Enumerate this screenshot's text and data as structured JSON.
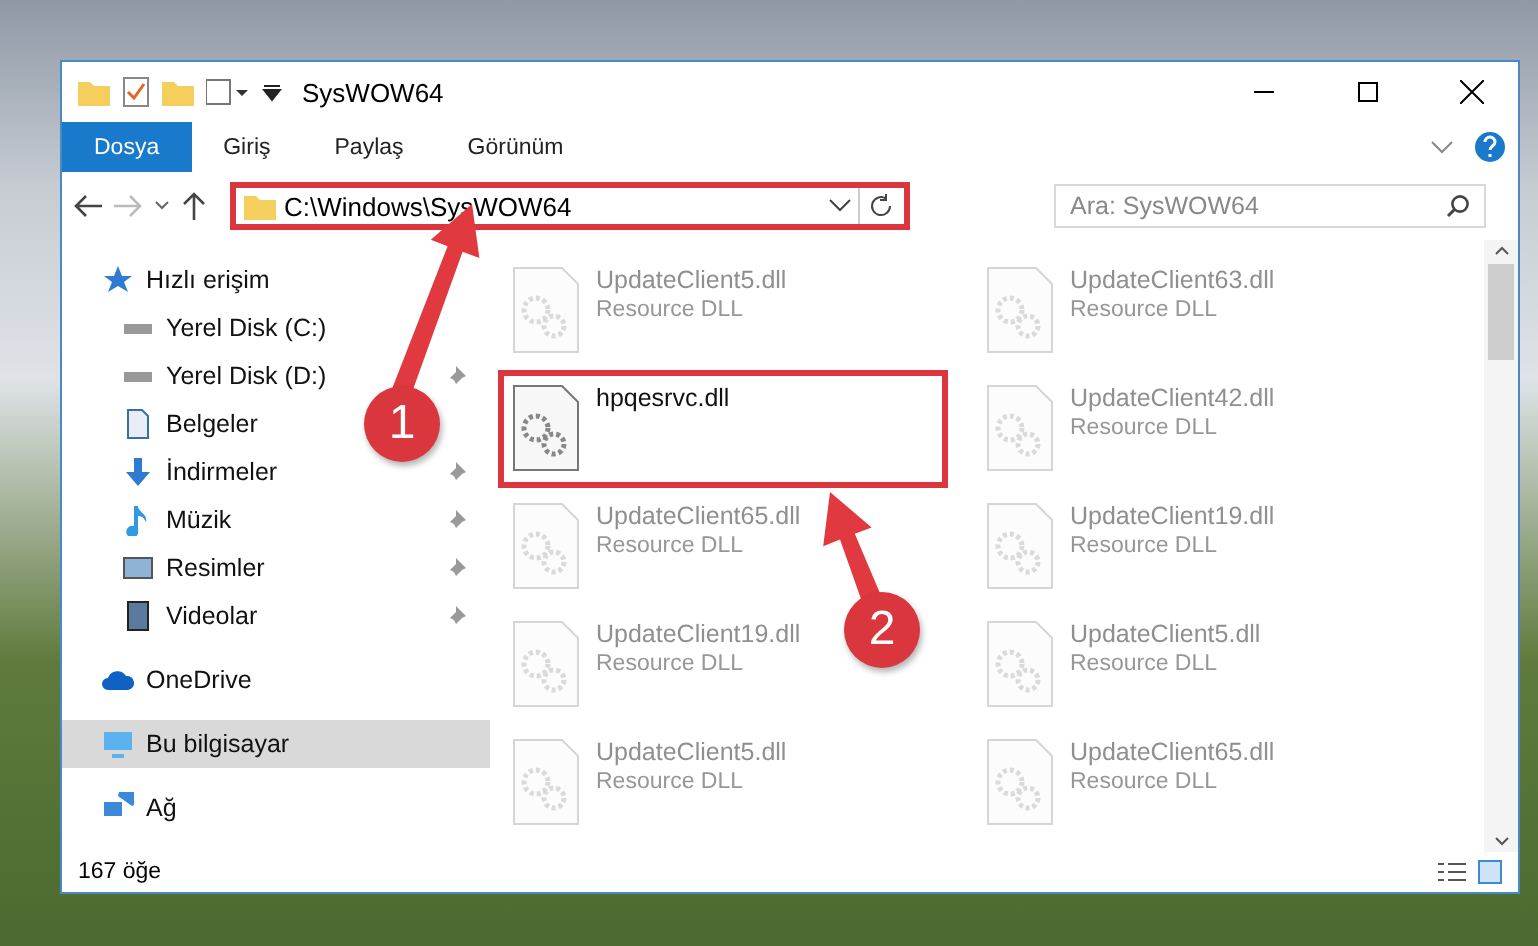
{
  "window": {
    "title": "SysWOW64"
  },
  "ribbon_tabs": [
    {
      "label": "Dosya",
      "selected": true
    },
    {
      "label": "Giriş",
      "selected": false
    },
    {
      "label": "Paylaş",
      "selected": false
    },
    {
      "label": "Görünüm",
      "selected": false
    }
  ],
  "address_bar": {
    "path": "C:\\Windows\\SysWOW64",
    "highlighted": true
  },
  "search": {
    "placeholder": "Ara: SysWOW64"
  },
  "sidebar": {
    "items": [
      {
        "label": "Hızlı erişim",
        "kind": "star",
        "pinned": false,
        "selected": false,
        "children": [
          {
            "label": "Yerel Disk (C:)",
            "kind": "drive",
            "pinned": false,
            "selected": false
          },
          {
            "label": "Yerel Disk (D:)",
            "kind": "drive",
            "pinned": true,
            "selected": false
          },
          {
            "label": "Belgeler",
            "kind": "document",
            "pinned": false,
            "selected": false
          },
          {
            "label": "İndirmeler",
            "kind": "download",
            "pinned": true,
            "selected": false
          },
          {
            "label": "Müzik",
            "kind": "music",
            "pinned": true,
            "selected": false
          },
          {
            "label": "Resimler",
            "kind": "picture",
            "pinned": true,
            "selected": false
          },
          {
            "label": "Videolar",
            "kind": "video",
            "pinned": true,
            "selected": false
          }
        ]
      },
      {
        "label": "OneDrive",
        "kind": "cloud",
        "pinned": false,
        "selected": false
      },
      {
        "label": "Bu bilgisayar",
        "kind": "computer",
        "pinned": false,
        "selected": true
      },
      {
        "label": "Ağ",
        "kind": "network",
        "pinned": false,
        "selected": false
      }
    ]
  },
  "files": [
    {
      "name": "UpdateClient5.dll",
      "type": "Resource DLL",
      "highlighted": false
    },
    {
      "name": "UpdateClient63.dll",
      "type": "Resource DLL",
      "highlighted": false
    },
    {
      "name": "hpqesrvc.dll",
      "highlighted": true
    },
    {
      "name": "UpdateClient42.dll",
      "type": "Resource DLL",
      "highlighted": false
    },
    {
      "name": "UpdateClient65.dll",
      "type": "Resource DLL",
      "highlighted": false
    },
    {
      "name": "UpdateClient19.dll",
      "type": "Resource DLL",
      "highlighted": false
    },
    {
      "name": "UpdateClient19.dll",
      "type": "Resource DLL",
      "highlighted": false
    },
    {
      "name": "UpdateClient5.dll",
      "type": "Resource DLL",
      "highlighted": false
    },
    {
      "name": "UpdateClient5.dll",
      "type": "Resource DLL",
      "highlighted": false
    },
    {
      "name": "UpdateClient65.dll",
      "type": "Resource DLL",
      "highlighted": false
    }
  ],
  "status_bar": {
    "count": "167 öğe"
  },
  "callouts": [
    {
      "number": "1"
    },
    {
      "number": "2"
    }
  ]
}
